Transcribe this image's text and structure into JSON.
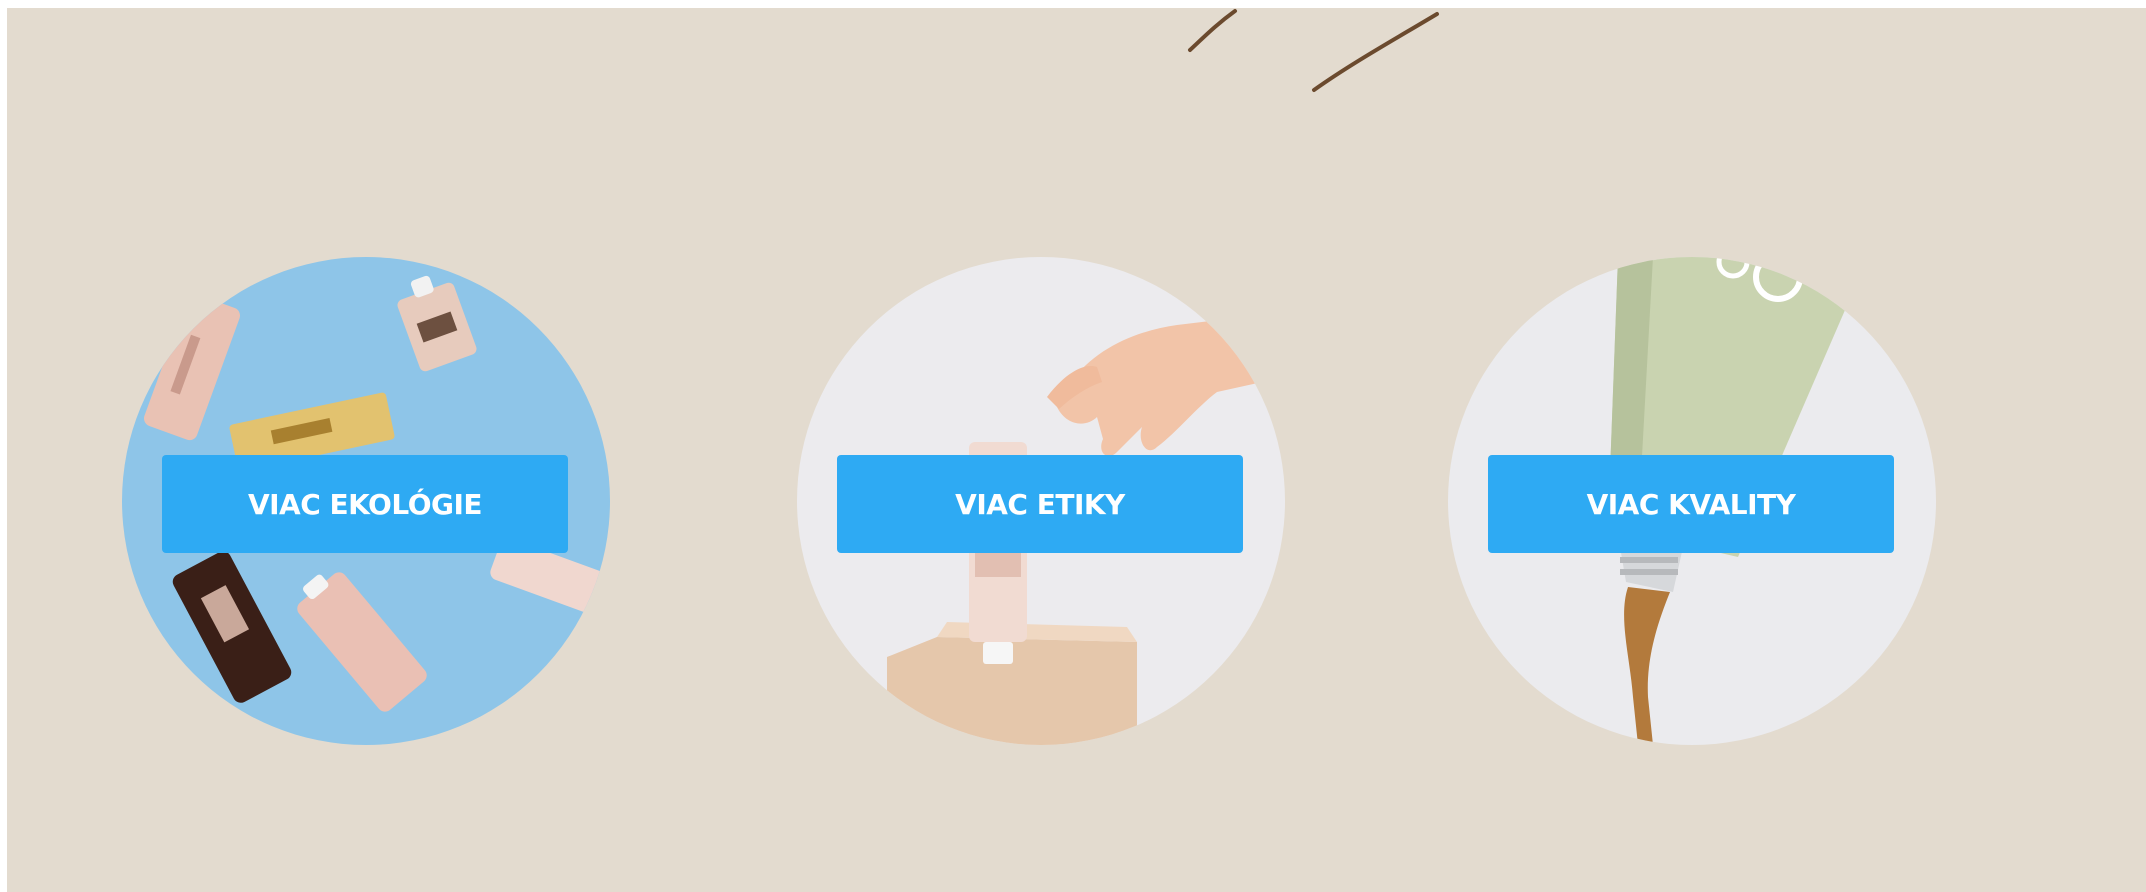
{
  "cards": [
    {
      "label": "VIAC EKOLÓGIE",
      "image": "tubes-on-blue-background"
    },
    {
      "label": "VIAC ETIKY",
      "image": "hand-reaching-tube-on-pedestal"
    },
    {
      "label": "VIAC KVALITY",
      "image": "green-tube-squeezing-liquid"
    }
  ],
  "colors": {
    "page_background": "#e3dbcf",
    "button": "#2eaaf3",
    "button_text": "#ffffff",
    "accent_line": "#6b4a2e"
  }
}
